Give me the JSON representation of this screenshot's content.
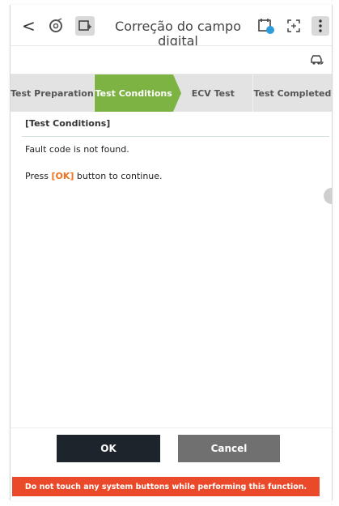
{
  "header": {
    "back_glyph": "<",
    "title_line1": "Correção do campo",
    "title_line2": "digital",
    "icons": [
      "back-icon",
      "disc-icon",
      "image-plus-icon",
      "calendar-badge-icon",
      "fullscreen-icon",
      "more-vert-icon",
      "car-icon"
    ]
  },
  "steps": [
    {
      "label": "Test Preparation",
      "active": false
    },
    {
      "label": "Test Conditions",
      "active": true
    },
    {
      "label": "ECV Test",
      "active": false
    },
    {
      "label": "Test Completed",
      "active": false
    }
  ],
  "content": {
    "section_title": "[Test Conditions]",
    "line1": "Fault code is not found.",
    "line2_prefix": "Press ",
    "line2_key": "[OK]",
    "line2_suffix": " button to continue."
  },
  "buttons": {
    "ok_label": "OK",
    "cancel_label": "Cancel"
  },
  "warning_text": "Do not touch any system buttons while performing this function.",
  "colors": {
    "active_step": "#7cb342",
    "ok_button": "#1e242b",
    "cancel_button": "#707070",
    "warning_bar": "#ea4a2a",
    "ok_key_text": "#f2711c"
  }
}
